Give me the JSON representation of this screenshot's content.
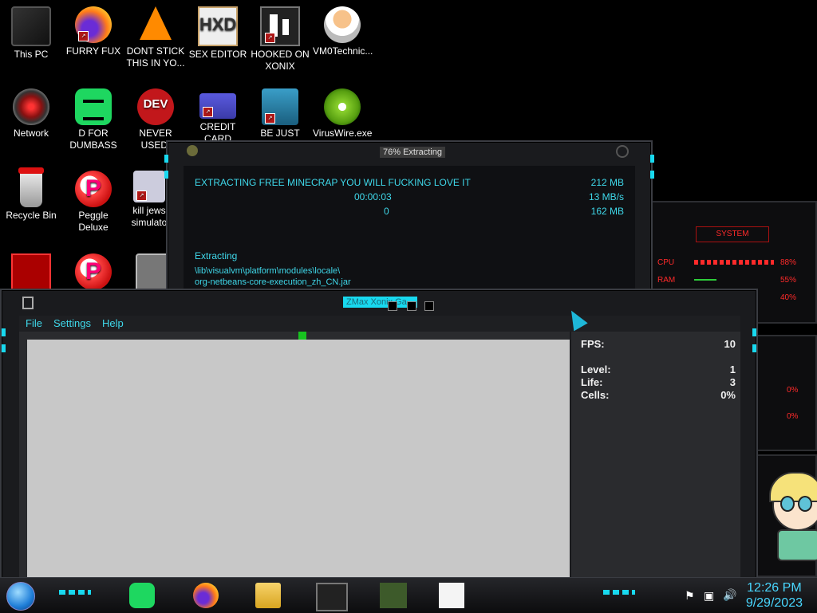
{
  "desktop": {
    "icons": [
      {
        "label": "This PC"
      },
      {
        "label": "FURRY FUX"
      },
      {
        "label": "DONT STICK THIS IN YO..."
      },
      {
        "label": "SEX EDITOR"
      },
      {
        "label": "HOOKED ON XONIX"
      },
      {
        "label": "VM0Technic..."
      },
      {
        "label": "Network"
      },
      {
        "label": "D FOR DUMBASS"
      },
      {
        "label": "NEVER USED!"
      },
      {
        "label": "CREDIT CARD"
      },
      {
        "label": "BE JUST LIKE"
      },
      {
        "label": "VirusWire.exe"
      },
      {
        "label": "Recycle Bin"
      },
      {
        "label": "Peggle Deluxe"
      },
      {
        "label": "kill jews simulato"
      }
    ],
    "hxd_glyph": "HXD",
    "dev_glyph": "DEV",
    "peggle_glyph": "P"
  },
  "extract_window": {
    "title": "76% Extracting",
    "filename": "EXTRACTING FREE MINECRAP YOU WILL FUCKING LOVE IT",
    "elapsed": "00:00:03",
    "remaining": "0",
    "size_total": "212 MB",
    "speed": "13 MB/s",
    "size_done": "162 MB",
    "status": "Extracting",
    "path1": "\\lib\\visualvm\\platform\\modules\\locale\\",
    "path2": "org-netbeans-core-execution_zh_CN.jar",
    "progress_percent": 76
  },
  "xonix_window": {
    "title": "ZMax Xonix Ga...",
    "menu": {
      "file": "File",
      "settings": "Settings",
      "help": "Help"
    },
    "stats": {
      "fps_label": "FPS:",
      "fps": "10",
      "level_label": "Level:",
      "level": "1",
      "life_label": "Life:",
      "life": "3",
      "cells_label": "Cells:",
      "cells": "0%"
    }
  },
  "system_gauge": {
    "title": "SYSTEM",
    "cpu_label": "CPU",
    "cpu_value": "88%",
    "ram_label": "RAM",
    "ram_value": "55%",
    "row3_value": "40%",
    "row4_value": "0%",
    "row5_value": "0%"
  },
  "taskbar": {
    "time": "12:26 PM",
    "date": "9/29/2023"
  },
  "colors": {
    "accent": "#18d9ef",
    "text_cyan": "#3fd8ea",
    "gauge_red": "#ff2a2a",
    "clock": "#49d7ff"
  }
}
